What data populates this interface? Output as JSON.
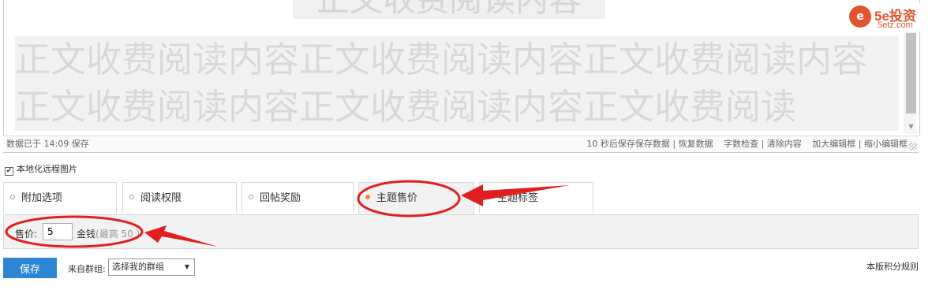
{
  "editor": {
    "ghost_text": "正文收费阅读内容",
    "content_text": "正文收费阅读内容正文收费阅读内容正文收费阅读内容正文收费阅读内容正文收费阅读内容正文收费阅读",
    "status_left": "数据已于 14:09 保存",
    "status_links": [
      "10 秒后保存",
      "保存数据",
      "恢复数据",
      "字数检查",
      "清除内容",
      "加大编辑框",
      "缩小编辑框"
    ]
  },
  "logo": {
    "emblem": "e",
    "brand": "5e投资",
    "site": "5etz.com"
  },
  "options": {
    "localize_images_label": "本地化远程图片",
    "localize_images_checked": true
  },
  "tabs": [
    {
      "label": "附加选项"
    },
    {
      "label": "阅读权限"
    },
    {
      "label": "回帖奖励"
    },
    {
      "label": "主题售价",
      "active": true
    },
    {
      "label": "主题标签"
    }
  ],
  "price_panel": {
    "price_label": "售价:",
    "price_value": "5",
    "unit": "金钱",
    "hint": "(最高 50 )"
  },
  "footer": {
    "save_label": "保存",
    "group_label": "来自群组:",
    "group_selected": "选择我的群组",
    "rules_label": "本版积分规则"
  },
  "colors": {
    "accent": "#2d86d3",
    "annotation": "#e02020",
    "active_dot": "#f08a23"
  }
}
